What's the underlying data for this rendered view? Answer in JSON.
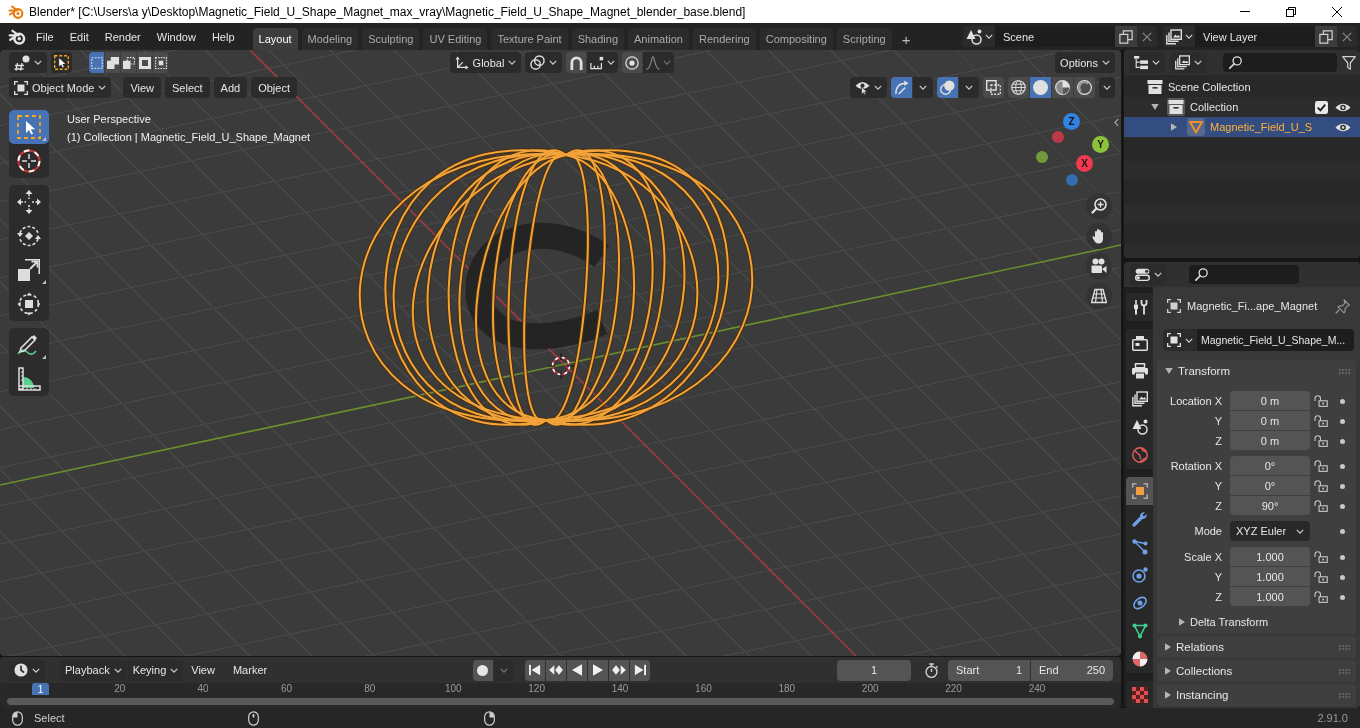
{
  "window": {
    "title": "Blender* [C:\\Users\\a y\\Desktop\\Magnetic_Field_U_Shape_Magnet_max_vray\\Magnetic_Field_U_Shape_Magnet_blender_base.blend]"
  },
  "menu_bar": {
    "menus": [
      "File",
      "Edit",
      "Render",
      "Window",
      "Help"
    ],
    "workspaces": [
      {
        "label": "Layout",
        "selected": true
      },
      {
        "label": "Modeling",
        "selected": false
      },
      {
        "label": "Sculpting",
        "selected": false
      },
      {
        "label": "UV Editing",
        "selected": false
      },
      {
        "label": "Texture Paint",
        "selected": false
      },
      {
        "label": "Shading",
        "selected": false
      },
      {
        "label": "Animation",
        "selected": false
      },
      {
        "label": "Rendering",
        "selected": false
      },
      {
        "label": "Compositing",
        "selected": false
      },
      {
        "label": "Scripting",
        "selected": false
      }
    ],
    "add_workspace": "+",
    "scene": "Scene",
    "view_layer": "View Layer"
  },
  "viewport": {
    "select_modes": [
      {
        "kind": "set",
        "selected": true
      },
      {
        "kind": "extend",
        "selected": false
      },
      {
        "kind": "subtract",
        "selected": false
      },
      {
        "kind": "invert",
        "selected": false
      },
      {
        "kind": "intersect",
        "selected": false
      }
    ],
    "orientation": "Global",
    "snap_on": false,
    "proportional_on": false,
    "options": "Options",
    "mode": "Object Mode",
    "menus": [
      "View",
      "Select",
      "Add",
      "Object"
    ],
    "gizmos_on": true,
    "overlays_on": true,
    "xray_on": false,
    "shading": [
      {
        "kind": "wireframe",
        "selected": false
      },
      {
        "kind": "solid",
        "selected": true
      },
      {
        "kind": "material",
        "selected": false
      },
      {
        "kind": "rendered",
        "selected": false
      }
    ],
    "tool_groups": [
      {
        "tools": [
          {
            "kind": "select",
            "selected": true,
            "more": true
          },
          {
            "kind": "cursor",
            "selected": false,
            "more": false
          }
        ]
      },
      {
        "tools": [
          {
            "kind": "move",
            "selected": false,
            "more": false
          },
          {
            "kind": "rotate",
            "selected": false,
            "more": false
          },
          {
            "kind": "scale",
            "selected": false,
            "more": true
          },
          {
            "kind": "transform",
            "selected": false,
            "more": false
          }
        ]
      },
      {
        "tools": [
          {
            "kind": "annotate",
            "selected": false,
            "more": true
          },
          {
            "kind": "measure",
            "selected": false,
            "more": false
          }
        ]
      }
    ],
    "info": [
      "User Perspective",
      "(1) Collection | Magnetic_Field_U_Shape_Magnet"
    ],
    "axes": [
      {
        "label": "Z",
        "color": "#2f83e3"
      },
      {
        "label": "Y",
        "color": "#8bc33a"
      },
      {
        "label": "X",
        "color": "#f03a4f"
      }
    ]
  },
  "outliner": {
    "items": [
      {
        "label": "Scene Collection",
        "kind": "scene",
        "active": false,
        "selected": false,
        "children": [
          {
            "label": "Collection",
            "kind": "collection",
            "active": true,
            "expanded": true,
            "selected": false,
            "checked": true,
            "visible": true,
            "children": [
              {
                "label": "Magnetic_Field_U_S",
                "kind": "mesh",
                "active": true,
                "expanded": false,
                "selected": true,
                "visible": true
              }
            ]
          }
        ]
      }
    ]
  },
  "properties": {
    "tab_groups": [
      {
        "tabs": [
          {
            "kind": "tool",
            "selected": false
          }
        ]
      },
      {
        "tabs": [
          {
            "kind": "render",
            "selected": false
          },
          {
            "kind": "output",
            "selected": false
          },
          {
            "kind": "view_layer",
            "selected": false
          },
          {
            "kind": "scene",
            "selected": false
          },
          {
            "kind": "world",
            "selected": false
          }
        ]
      },
      {
        "tabs": [
          {
            "kind": "object",
            "selected": true
          },
          {
            "kind": "modifiers",
            "selected": false
          },
          {
            "kind": "particles",
            "selected": false
          },
          {
            "kind": "physics",
            "selected": false
          },
          {
            "kind": "constraints",
            "selected": false
          },
          {
            "kind": "data",
            "selected": false
          },
          {
            "kind": "material",
            "selected": false
          }
        ]
      },
      {
        "tabs": [
          {
            "kind": "texture",
            "selected": false
          }
        ]
      }
    ],
    "object_name": "Magnetic_Fi...ape_Magnet",
    "data_block": "Magnetic_Field_U_Shape_M...",
    "panels": [
      {
        "title": "Transform",
        "expanded": true,
        "sections": [
          {
            "kind": "vector",
            "rows": [
              {
                "label": "Location X",
                "value": "0 m",
                "locked": false
              },
              {
                "label": "Y",
                "value": "0 m",
                "locked": false
              },
              {
                "label": "Z",
                "value": "0 m",
                "locked": false
              }
            ]
          },
          {
            "kind": "vector",
            "rows": [
              {
                "label": "Rotation X",
                "value": "0°",
                "locked": false
              },
              {
                "label": "Y",
                "value": "0°",
                "locked": false
              },
              {
                "label": "Z",
                "value": "90°",
                "locked": false
              }
            ]
          },
          {
            "kind": "dropdown",
            "label": "Mode",
            "value": "XYZ Euler"
          },
          {
            "kind": "vector",
            "rows": [
              {
                "label": "Scale X",
                "value": "1.000",
                "locked": false
              },
              {
                "label": "Y",
                "value": "1.000",
                "locked": false
              },
              {
                "label": "Z",
                "value": "1.000",
                "locked": false
              }
            ]
          }
        ],
        "subpanels": [
          {
            "title": "Delta Transform",
            "expanded": false
          }
        ]
      },
      {
        "title": "Relations",
        "expanded": false
      },
      {
        "title": "Collections",
        "expanded": false
      },
      {
        "title": "Instancing",
        "expanded": false
      }
    ]
  },
  "timeline": {
    "menus": [
      {
        "label": "Playback",
        "kind": "dropdown"
      },
      {
        "label": "Keying",
        "kind": "dropdown"
      },
      {
        "label": "View",
        "kind": "menu"
      },
      {
        "label": "Marker",
        "kind": "menu"
      }
    ],
    "auto_keying_on": false,
    "current_frame": "1",
    "start_label": "Start",
    "start": "1",
    "end_label": "End",
    "end": "250",
    "ruler_current": "1",
    "ruler_ticks": [
      "20",
      "40",
      "60",
      "80",
      "100",
      "120",
      "140",
      "160",
      "180",
      "200",
      "220",
      "240"
    ]
  },
  "status_bar": {
    "hint": "Select",
    "version": "2.91.0"
  }
}
